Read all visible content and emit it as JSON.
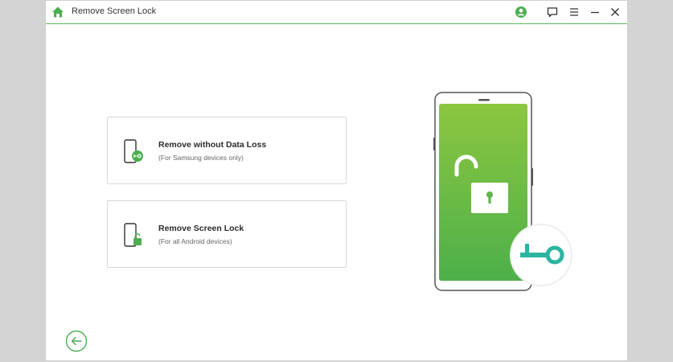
{
  "window": {
    "title": "Remove Screen Lock",
    "icons": [
      "home-icon",
      "user-icon",
      "feedback-icon",
      "menu-icon",
      "minimize-icon",
      "close-icon"
    ]
  },
  "options": [
    {
      "title": "Remove without Data Loss",
      "subtitle": "(For Samsung devices only)",
      "icon": "phone-key-icon"
    },
    {
      "title": "Remove Screen Lock",
      "subtitle": "(For all Android devices)",
      "icon": "phone-lock-icon"
    }
  ],
  "colors": {
    "accent": "#4caf50",
    "teal": "#2bb5a0",
    "phone_green_top": "#8cc63f",
    "phone_green_bottom": "#4db04a"
  },
  "footer": {
    "back_icon": "arrow-left-icon"
  }
}
